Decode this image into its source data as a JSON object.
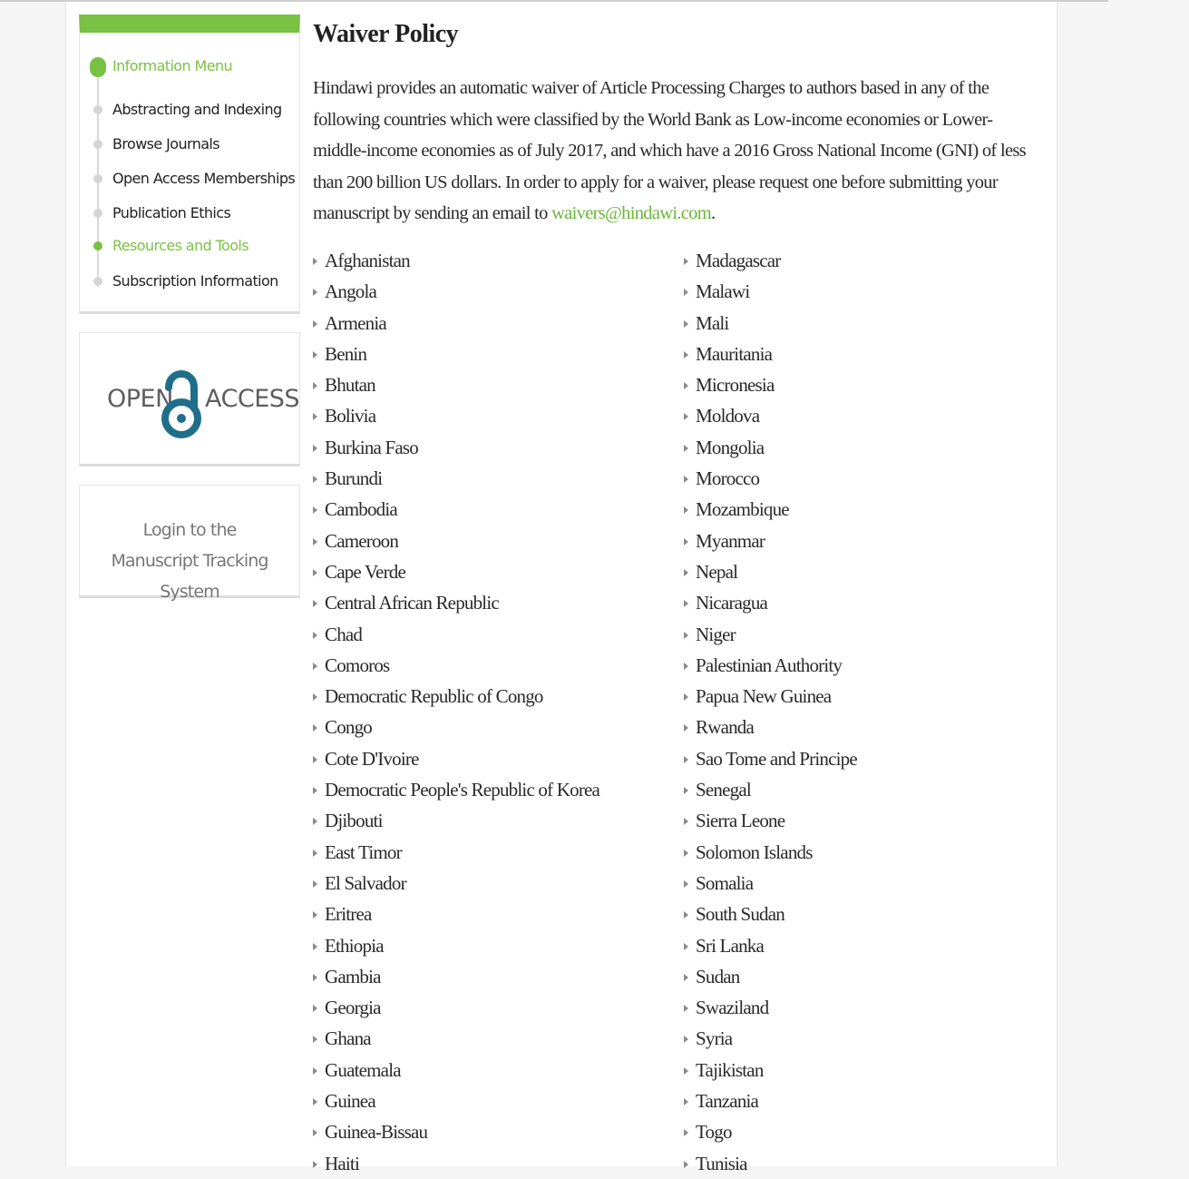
{
  "sidebar": {
    "menu_heading": "Information Menu",
    "menu_items": [
      {
        "label": "Abstracting and Indexing"
      },
      {
        "label": "Browse Journals"
      },
      {
        "label": "Open Access Memberships"
      },
      {
        "label": "Publication Ethics"
      },
      {
        "label": "Resources and Tools",
        "active": true
      },
      {
        "label": "Subscription Information"
      }
    ],
    "open_access_logo": {
      "left_text": "OPEN",
      "right_text": "ACCESS",
      "icon": "open-lock-icon"
    },
    "login_link": "Login to the Manuscript Tracking System"
  },
  "main": {
    "title": "Waiver Policy",
    "intro_text": "Hindawi provides an automatic waiver of Article Processing Charges to authors based in any of the following countries which were classified by the World Bank as Low-income economies or Lower-middle-income economies as of July 2017, and which have a 2016 Gross National Income (GNI) of less than 200 billion US dollars. In order to apply for a waiver, please request one before submitting your manuscript by sending an email to ",
    "email_link": "waivers@hindawi.com",
    "intro_end": ".",
    "countries_left": [
      "Afghanistan",
      "Angola",
      "Armenia",
      "Benin",
      "Bhutan",
      "Bolivia",
      "Burkina Faso",
      "Burundi",
      "Cambodia",
      "Cameroon",
      "Cape Verde",
      "Central African Republic",
      "Chad",
      "Comoros",
      "Democratic Republic of Congo",
      "Congo",
      "Cote D'Ivoire",
      "Democratic People's Republic of Korea",
      "Djibouti",
      "East Timor",
      "El Salvador",
      "Eritrea",
      "Ethiopia",
      "Gambia",
      "Georgia",
      "Ghana",
      "Guatemala",
      "Guinea",
      "Guinea-Bissau",
      "Haiti"
    ],
    "countries_right": [
      "Madagascar",
      "Malawi",
      "Mali",
      "Mauritania",
      "Micronesia",
      "Moldova",
      "Mongolia",
      "Morocco",
      "Mozambique",
      "Myanmar",
      "Nepal",
      "Nicaragua",
      "Niger",
      "Palestinian Authority",
      "Papua New Guinea",
      "Rwanda",
      "Sao Tome and Principe",
      "Senegal",
      "Sierra Leone",
      "Solomon Islands",
      "Somalia",
      "South Sudan",
      "Sri Lanka",
      "Sudan",
      "Swaziland",
      "Syria",
      "Tajikistan",
      "Tanzania",
      "Togo",
      "Tunisia"
    ]
  },
  "colors": {
    "accent": "#78c143",
    "link": "#6ab63a",
    "text": "#222222"
  }
}
